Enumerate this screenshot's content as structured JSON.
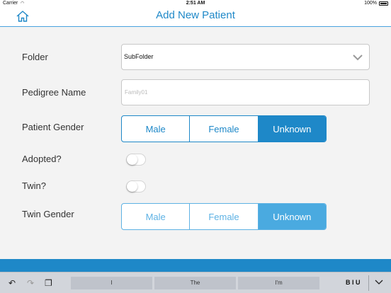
{
  "status": {
    "carrier": "Carrier",
    "time": "2:51 AM",
    "battery": "100%"
  },
  "nav": {
    "title": "Add New Patient",
    "home_icon": "home-icon"
  },
  "form": {
    "folder": {
      "label": "Folder",
      "value": "SubFolder"
    },
    "pedigree": {
      "label": "Pedigree Name",
      "placeholder": "Family01",
      "value": ""
    },
    "patient_gender": {
      "label": "Patient Gender",
      "options": [
        "Male",
        "Female",
        "Unknown"
      ],
      "selected": "Unknown"
    },
    "adopted": {
      "label": "Adopted?",
      "on": false
    },
    "twin": {
      "label": "Twin?",
      "on": false
    },
    "twin_gender": {
      "label": "Twin Gender",
      "options": [
        "Male",
        "Female",
        "Unknown"
      ],
      "selected": "Unknown",
      "enabled": false
    }
  },
  "keyboard": {
    "suggestions": [
      "I",
      "The",
      "I'm"
    ],
    "format_label": "B I U"
  },
  "colors": {
    "accent": "#1e88c8",
    "background": "#f3f3f3"
  }
}
